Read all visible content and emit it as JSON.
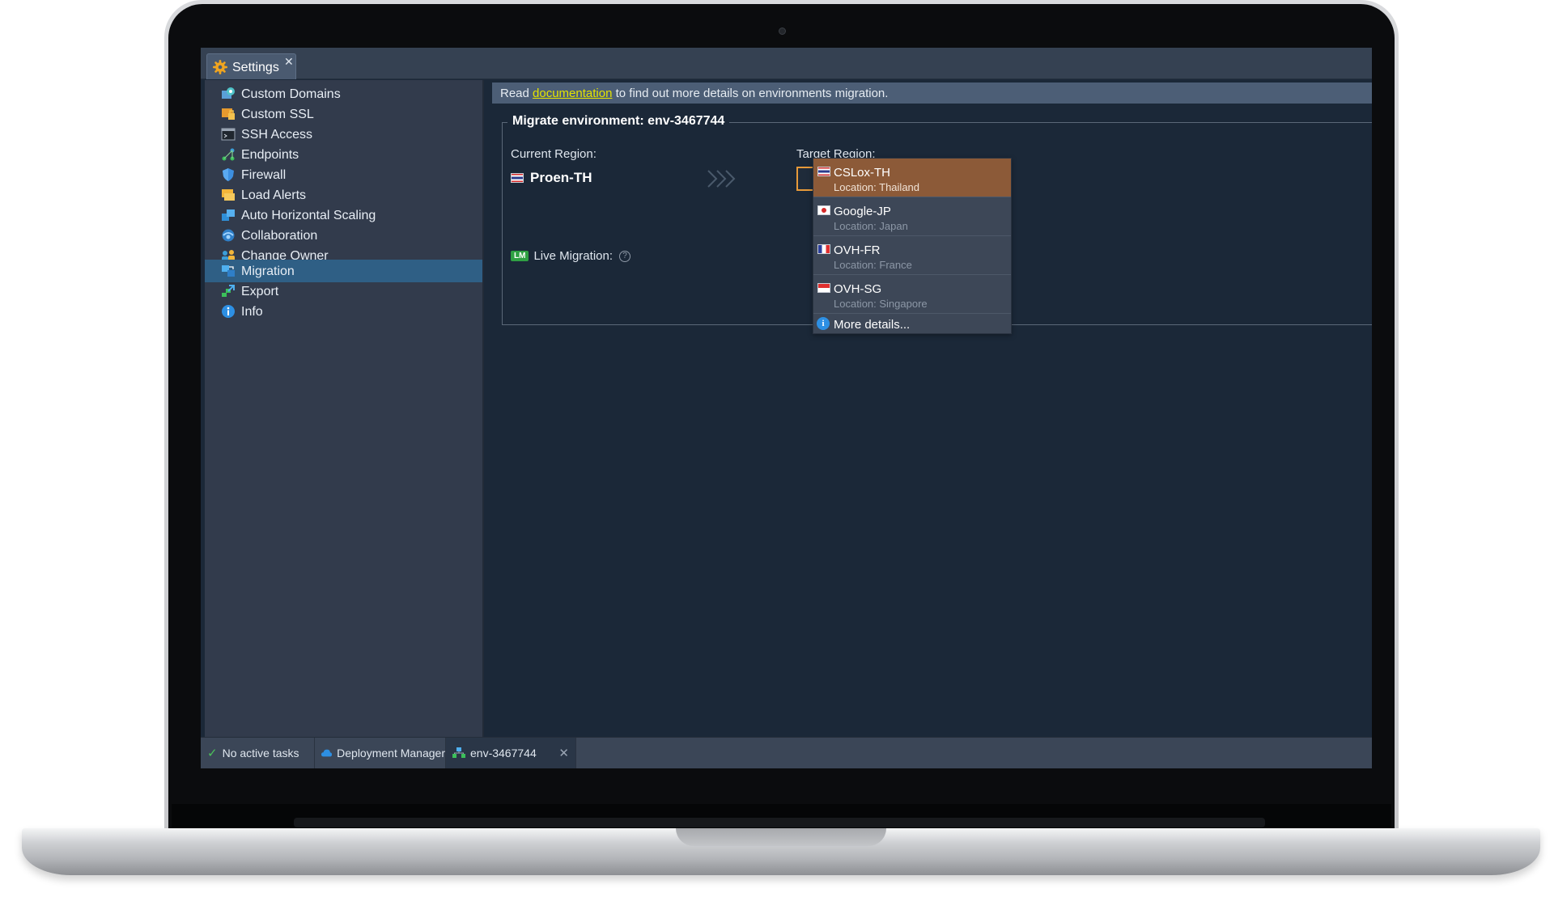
{
  "window": {
    "tab_label": "Settings",
    "tab_close": "✕"
  },
  "sidebar": {
    "items": [
      {
        "label": "Custom Domains",
        "icon": "custom-domains-icon"
      },
      {
        "label": "Custom SSL",
        "icon": "ssl-icon"
      },
      {
        "label": "SSH Access",
        "icon": "terminal-icon"
      },
      {
        "label": "Endpoints",
        "icon": "endpoints-icon"
      },
      {
        "label": "Firewall",
        "icon": "shield-icon"
      },
      {
        "label": "Load Alerts",
        "icon": "alert-icon"
      },
      {
        "label": "Auto Horizontal Scaling",
        "icon": "scaling-icon"
      },
      {
        "label": "Collaboration",
        "icon": "collaboration-icon"
      },
      {
        "label": "Change Owner",
        "icon": "change-owner-icon"
      },
      {
        "label": "Migration",
        "icon": "migration-icon"
      },
      {
        "label": "Export",
        "icon": "export-icon"
      },
      {
        "label": "Info",
        "icon": "info-icon"
      }
    ],
    "active": "Migration"
  },
  "main": {
    "info_prefix": "Read ",
    "info_link": "documentation",
    "info_suffix": " to find out more details on environments migration.",
    "legend": "Migrate environment: env-3467744",
    "current_region_label": "Current Region:",
    "current_region_value": "Proen-TH",
    "target_region_label": "Target Region:",
    "target_region_value": "",
    "live_migration_badge": "LM",
    "live_migration_label": "Live Migration:",
    "help_glyph": "?"
  },
  "dropdown": {
    "options": [
      {
        "name": "CSLox-TH",
        "location": "Location: Thailand",
        "flag": "th",
        "selected": true
      },
      {
        "name": "Google-JP",
        "location": "Location: Japan",
        "flag": "jp",
        "selected": false
      },
      {
        "name": "OVH-FR",
        "location": "Location: France",
        "flag": "fr",
        "selected": false
      },
      {
        "name": "OVH-SG",
        "location": "Location: Singapore",
        "flag": "sg",
        "selected": false
      }
    ],
    "more_label": "More details...",
    "more_glyph": "i"
  },
  "taskbar": {
    "status_check": "✓",
    "status": "No active tasks",
    "deployment_manager": "Deployment Manager",
    "env_tab": "env-3467744",
    "env_close": "✕"
  },
  "colors": {
    "accent_orange": "#e79a3a",
    "selected_option": "#8c5a38",
    "active_sidebar": "#2f5f85",
    "link_yellow": "#e4e400",
    "success_green": "#2fa043"
  }
}
